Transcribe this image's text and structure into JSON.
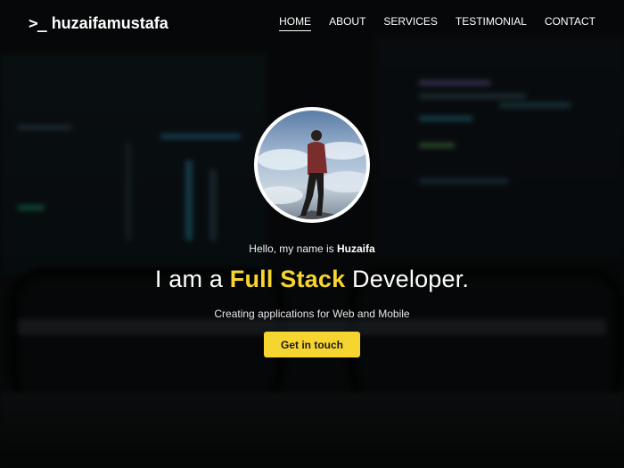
{
  "brand": {
    "prompt_glyph": ">_",
    "name": "huzaifamustafa"
  },
  "nav": {
    "items": [
      {
        "label": "HOME",
        "active": true
      },
      {
        "label": "ABOUT",
        "active": false
      },
      {
        "label": "SERVICES",
        "active": false
      },
      {
        "label": "TESTIMONIAL",
        "active": false
      },
      {
        "label": "CONTACT",
        "active": false
      }
    ]
  },
  "hero": {
    "greeting_prefix": "Hello, my name is",
    "greeting_name": "Huzaifa",
    "headline_start": "I am a",
    "headline_accent": "Full Stack",
    "headline_end": "Developer.",
    "tagline": "Creating applications for Web and Mobile",
    "cta_label": "Get in touch"
  },
  "colors": {
    "accent": "#f7d531",
    "text": "#ffffff",
    "overlay": "rgba(0,0,0,0.55)"
  },
  "icons": {
    "avatar": "profile-photo"
  }
}
